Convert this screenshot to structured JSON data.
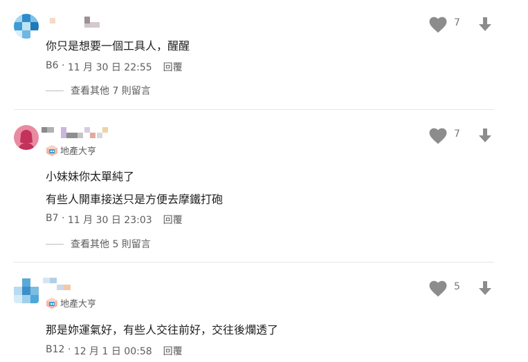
{
  "comments": [
    {
      "lines": [
        "你只是想要一個工具人，醒醒"
      ],
      "floor": "B6",
      "time": "11 月 30 日 22:55",
      "reply_label": "回覆",
      "likes": "7",
      "more_label": "查看其他 7 則留言"
    },
    {
      "badge": "地產大亨",
      "lines": [
        "小妹妹你太單純了",
        "有些人開車接送只是方便去摩鐵打砲"
      ],
      "floor": "B7",
      "time": "11 月 30 日 23:03",
      "reply_label": "回覆",
      "likes": "7",
      "more_label": "查看其他 5 則留言"
    },
    {
      "badge": "地產大亨",
      "lines": [
        "那是妳運氣好，有些人交往前好，交往後爛透了"
      ],
      "floor": "B12",
      "time": "12 月 1 日 00:58",
      "reply_label": "回覆",
      "likes": "5"
    }
  ],
  "meta_separator": " · ",
  "colors": {
    "icon_gray": "#8c8c8c",
    "text_secondary": "#5c5c5c",
    "avatar_pink": "#e98aa1",
    "avatar_blue": "#3d9bd6"
  },
  "icons": [
    "heart-icon",
    "arrow-down-icon",
    "realestate-badge-icon"
  ]
}
